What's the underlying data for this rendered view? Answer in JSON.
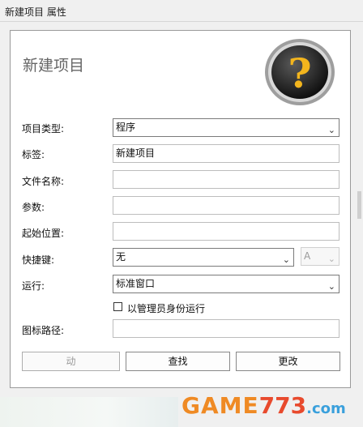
{
  "window": {
    "title": "新建项目 属性"
  },
  "heading": "新建项目",
  "icon": "question-mark-icon",
  "fields": {
    "type_label": "项目类型:",
    "type_value": "程序",
    "tag_label": "标签:",
    "tag_value": "新建项目",
    "filename_label": "文件名称:",
    "filename_value": "",
    "params_label": "参数:",
    "params_value": "",
    "start_label": "起始位置:",
    "start_value": "",
    "hotkey_label": "快捷键:",
    "hotkey_value": "无",
    "hotkey_key": "A",
    "run_label": "运行:",
    "run_value": "标准窗口",
    "admin_label": "以管理员身份运行",
    "admin_checked": false,
    "iconpath_label": "图标路径:",
    "iconpath_value": ""
  },
  "buttons": {
    "auto": "动",
    "find": "查找",
    "change": "更改"
  },
  "watermark": {
    "part1": "GAME",
    "part2": "773",
    "part3": ".com"
  }
}
